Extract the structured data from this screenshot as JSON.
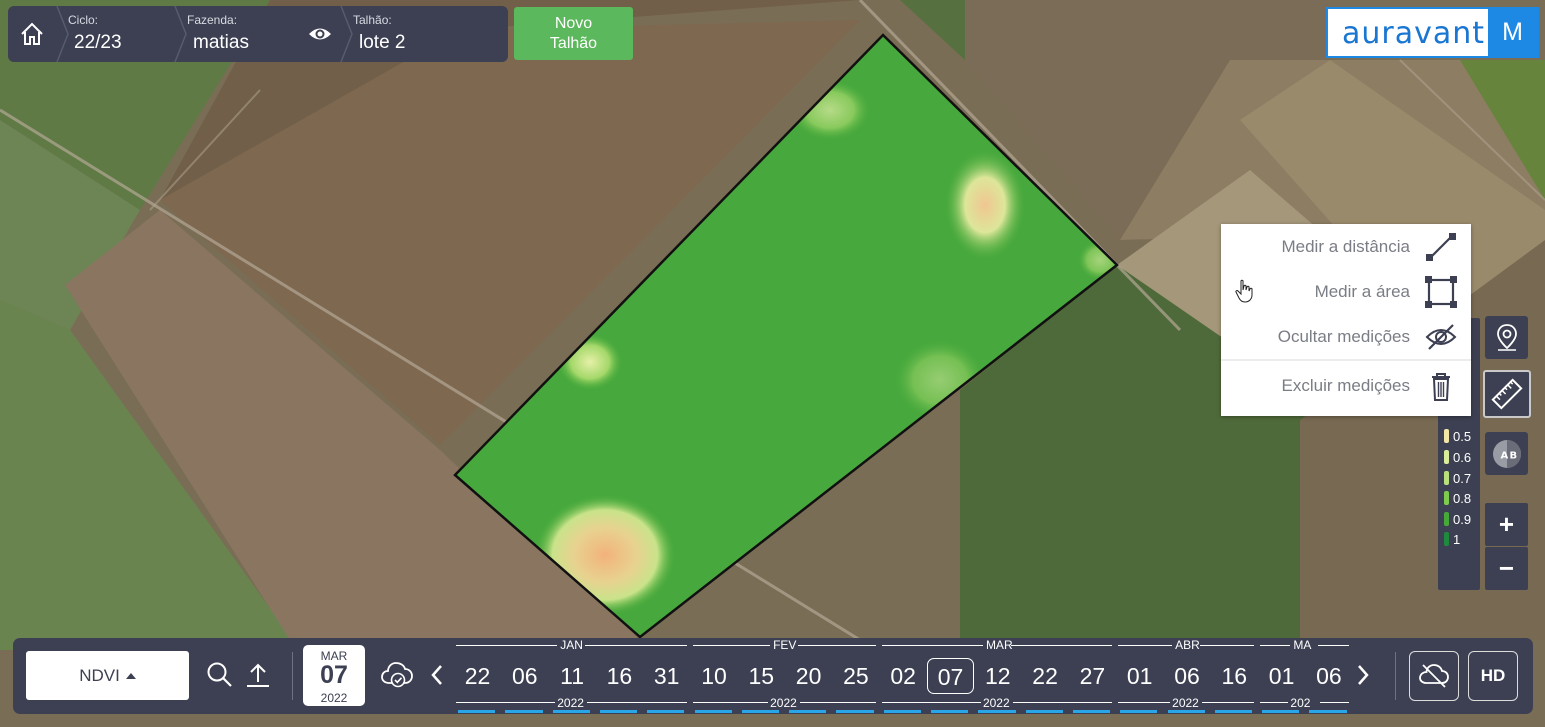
{
  "topbar": {
    "cycle": {
      "label": "Ciclo:",
      "value": "22/23"
    },
    "farm": {
      "label": "Fazenda:",
      "value": "matias"
    },
    "field": {
      "label": "Talhão:",
      "value": "lote 2"
    },
    "new_field_line1": "Novo",
    "new_field_line2": "Talhão"
  },
  "logo": {
    "brand": "auravant",
    "user_initial": "M",
    "color": "#1e88e5"
  },
  "measure_menu": {
    "items": [
      {
        "label": "Medir a distância",
        "icon": "line-measure-icon"
      },
      {
        "label": "Medir a área",
        "icon": "area-measure-icon"
      },
      {
        "label": "Ocultar medições",
        "icon": "eye-off-icon"
      },
      {
        "label": "Excluir medições",
        "icon": "trash-icon"
      }
    ]
  },
  "legend": {
    "visible_values": [
      "0.5",
      "0.6",
      "0.7",
      "0.8",
      "0.9",
      "1"
    ],
    "colors": [
      "#f1e6a6",
      "#d8ec9b",
      "#b8e07c",
      "#7dcc4d",
      "#47a83a",
      "#1f8a3e"
    ]
  },
  "zoom": {
    "in": "+",
    "out": "−"
  },
  "bottombar": {
    "index": "NDVI",
    "date": {
      "month": "MAR",
      "day": "07",
      "year": "2022"
    },
    "hd": "HD",
    "timeline": {
      "days": [
        "22",
        "06",
        "11",
        "16",
        "31",
        "10",
        "15",
        "20",
        "25",
        "02",
        "07",
        "12",
        "22",
        "27",
        "01",
        "06",
        "16",
        "01",
        "06"
      ],
      "selected_index": 10,
      "months": [
        "JAN",
        "FEV",
        "MAR",
        "ABR",
        "MA"
      ],
      "years": [
        "2022",
        "2022",
        "2022",
        "2022",
        "202"
      ]
    }
  },
  "colors": {
    "panel": "#3d4052",
    "accent_green": "#5cb85c",
    "coverage_blue": "#29a6e8"
  }
}
